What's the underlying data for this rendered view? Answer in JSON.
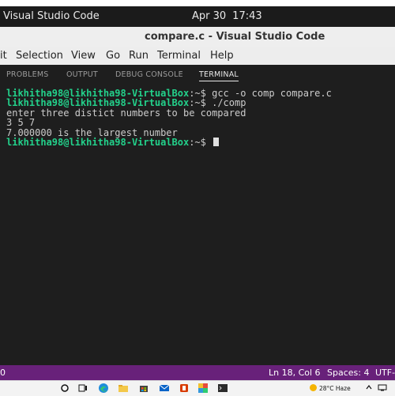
{
  "gnome": {
    "app_name": "Visual Studio Code",
    "date": "Apr 30",
    "time": "17:43"
  },
  "window": {
    "title": "compare.c - Visual Studio Code"
  },
  "menu": [
    "it",
    "Selection",
    "View",
    "Go",
    "Run",
    "Terminal",
    "Help"
  ],
  "panel_tabs": [
    "PROBLEMS",
    "OUTPUT",
    "DEBUG CONSOLE",
    "TERMINAL"
  ],
  "active_tab": "TERMINAL",
  "terminal": {
    "prompt": "likhitha98@likhitha98-VirtualBox",
    "prompt_suffix": ":~$",
    "lines": [
      {
        "type": "cmd",
        "text": " gcc -o comp compare.c"
      },
      {
        "type": "cmd",
        "text": " ./comp"
      },
      {
        "type": "out",
        "text": "enter three distict numbers to be compared"
      },
      {
        "type": "out",
        "text": "3 5 7"
      },
      {
        "type": "out",
        "text": "7.000000 is the largest number"
      },
      {
        "type": "cmd",
        "text": " "
      }
    ]
  },
  "status": {
    "left": "0",
    "position": "Ln 18, Col 6",
    "spaces": "Spaces: 4",
    "encoding": "UTF-"
  },
  "taskbar": {
    "icons": [
      "search-icon",
      "task-view-icon",
      "edge-icon",
      "file-explorer-icon",
      "store-icon",
      "mail-icon",
      "office-icon",
      "paint-icon",
      "terminal-icon"
    ],
    "weather_temp": "28°C",
    "weather_desc": "Haze",
    "accent": "#68217a"
  }
}
